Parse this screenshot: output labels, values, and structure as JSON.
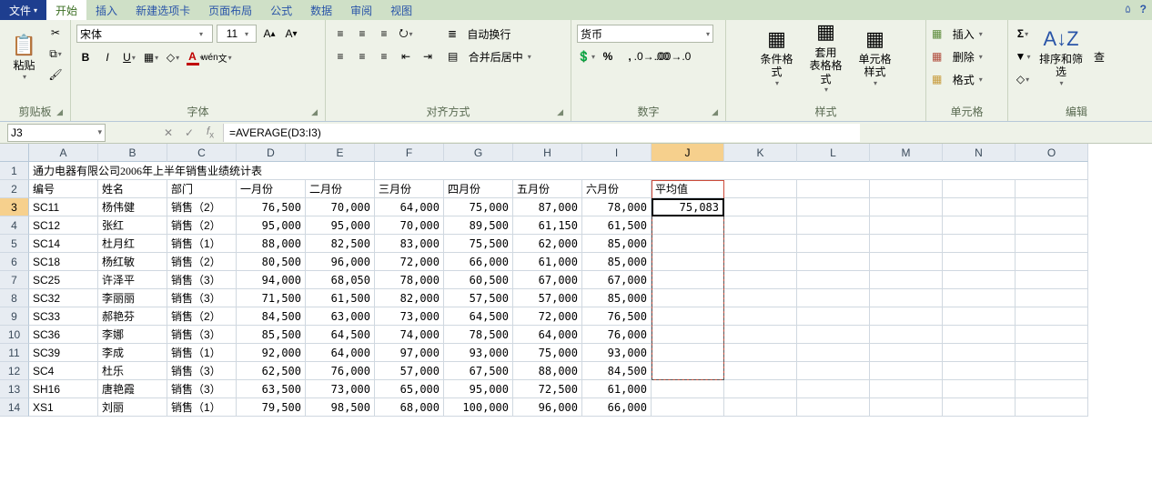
{
  "tabs": {
    "file": "文件",
    "active": "开始",
    "others": [
      "插入",
      "新建选项卡",
      "页面布局",
      "公式",
      "数据",
      "审阅",
      "视图"
    ]
  },
  "groups": {
    "clipboard": "剪贴板",
    "font": "字体",
    "align": "对齐方式",
    "number": "数字",
    "styles": "样式",
    "cells": "单元格",
    "editing": "编辑"
  },
  "clipboard": {
    "paste": "粘贴"
  },
  "font": {
    "name": "宋体",
    "size": "11"
  },
  "align": {
    "wrap": "自动换行",
    "merge": "合并后居中"
  },
  "number": {
    "format": "货币"
  },
  "styles": {
    "cond": "条件格式",
    "table": "套用\n表格格式",
    "cell": "单元格样式"
  },
  "cells": {
    "insert": "插入",
    "delete": "删除",
    "format": "格式"
  },
  "editing": {
    "sort": "排序和筛选",
    "find": "查"
  },
  "namebox": "J3",
  "formula": "=AVERAGE(D3:I3)",
  "columns": [
    "A",
    "B",
    "C",
    "D",
    "E",
    "F",
    "G",
    "H",
    "I",
    "J",
    "K",
    "L",
    "M",
    "N",
    "O"
  ],
  "activeCol": "J",
  "rowCount": 14,
  "activeRow": 3,
  "title": "通力电器有限公司2006年上半年销售业绩统计表",
  "headers": [
    "编号",
    "姓名",
    "部门",
    "一月份",
    "二月份",
    "三月份",
    "四月份",
    "五月份",
    "六月份",
    "平均值"
  ],
  "rows": [
    {
      "id": "SC11",
      "name": "杨伟健",
      "dept": "销售（2）",
      "m": [
        "76,500",
        "70,000",
        "64,000",
        "75,000",
        "87,000",
        "78,000"
      ],
      "avg": "75,083"
    },
    {
      "id": "SC12",
      "name": "张红",
      "dept": "销售（2）",
      "m": [
        "95,000",
        "95,000",
        "70,000",
        "89,500",
        "61,150",
        "61,500"
      ],
      "avg": ""
    },
    {
      "id": "SC14",
      "name": "杜月红",
      "dept": "销售（1）",
      "m": [
        "88,000",
        "82,500",
        "83,000",
        "75,500",
        "62,000",
        "85,000"
      ],
      "avg": ""
    },
    {
      "id": "SC18",
      "name": "杨红敏",
      "dept": "销售（2）",
      "m": [
        "80,500",
        "96,000",
        "72,000",
        "66,000",
        "61,000",
        "85,000"
      ],
      "avg": ""
    },
    {
      "id": "SC25",
      "name": "许泽平",
      "dept": "销售（3）",
      "m": [
        "94,000",
        "68,050",
        "78,000",
        "60,500",
        "67,000",
        "67,000"
      ],
      "avg": ""
    },
    {
      "id": "SC32",
      "name": "李丽丽",
      "dept": "销售（3）",
      "m": [
        "71,500",
        "61,500",
        "82,000",
        "57,500",
        "57,000",
        "85,000"
      ],
      "avg": ""
    },
    {
      "id": "SC33",
      "name": "郝艳芬",
      "dept": "销售（2）",
      "m": [
        "84,500",
        "63,000",
        "73,000",
        "64,500",
        "72,000",
        "76,500"
      ],
      "avg": ""
    },
    {
      "id": "SC36",
      "name": "李娜",
      "dept": "销售（3）",
      "m": [
        "85,500",
        "64,500",
        "74,000",
        "78,500",
        "64,000",
        "76,000"
      ],
      "avg": ""
    },
    {
      "id": "SC39",
      "name": "李成",
      "dept": "销售（1）",
      "m": [
        "92,000",
        "64,000",
        "97,000",
        "93,000",
        "75,000",
        "93,000"
      ],
      "avg": ""
    },
    {
      "id": "SC4",
      "name": "杜乐",
      "dept": "销售（3）",
      "m": [
        "62,500",
        "76,000",
        "57,000",
        "67,500",
        "88,000",
        "84,500"
      ],
      "avg": ""
    },
    {
      "id": "SH16",
      "name": "唐艳霞",
      "dept": "销售（3）",
      "m": [
        "63,500",
        "73,000",
        "65,000",
        "95,000",
        "72,500",
        "61,000"
      ],
      "avg": ""
    },
    {
      "id": "XS1",
      "name": "刘丽",
      "dept": "销售（1）",
      "m": [
        "79,500",
        "98,500",
        "68,000",
        "100,000",
        "96,000",
        "66,000"
      ],
      "avg": ""
    }
  ]
}
